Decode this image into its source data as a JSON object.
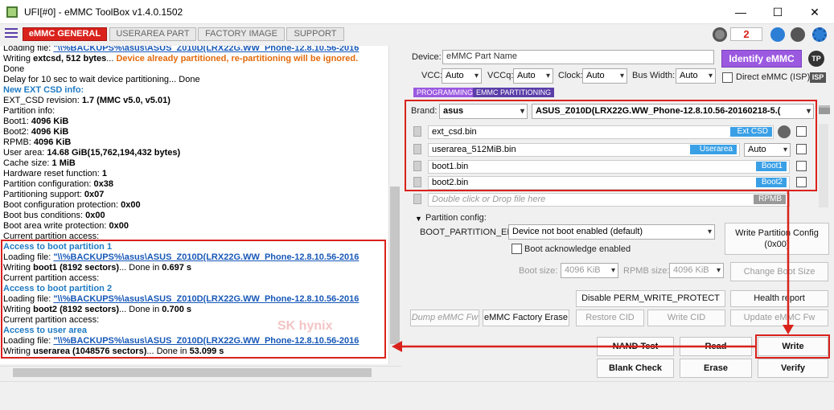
{
  "window": {
    "title": "UFI[#0] - eMMC ToolBox v1.4.0.1502",
    "min": "—",
    "max": "☐",
    "close": "✕"
  },
  "tabs": [
    "eMMC GENERAL",
    "USERAREA PART",
    "FACTORY IMAGE",
    "SUPPORT"
  ],
  "counter": "2",
  "log": [
    {
      "segs": [
        {
          "t": "Loading file:  "
        },
        {
          "t": "\"\\\\%BACKUPS%\\asus\\ASUS_Z010D(LRX22G.WW_Phone-12.8.10.56-2016",
          "c": "link"
        }
      ]
    },
    {
      "segs": [
        {
          "t": "Writing "
        },
        {
          "t": "extcsd, 512 bytes",
          "c": "b"
        },
        {
          "t": "... "
        },
        {
          "t": "Device already partitioned, re-partitioning will be ignored.",
          "c": "orange"
        }
      ]
    },
    {
      "segs": [
        {
          "t": "Done"
        }
      ]
    },
    {
      "segs": [
        {
          "t": "Delay for 10 sec to wait device partitioning... Done"
        }
      ]
    },
    {
      "segs": [
        {
          "t": "New EXT CSD info:",
          "c": "blue"
        }
      ]
    },
    {
      "segs": [
        {
          "t": "EXT_CSD revision: "
        },
        {
          "t": "1.7 (MMC v5.0, v5.01)",
          "c": "b"
        }
      ]
    },
    {
      "segs": [
        {
          "t": "Partition info:"
        }
      ]
    },
    {
      "segs": [
        {
          "t": " Boot1: "
        },
        {
          "t": "4096 KiB",
          "c": "b"
        }
      ]
    },
    {
      "segs": [
        {
          "t": " Boot2: "
        },
        {
          "t": "4096 KiB",
          "c": "b"
        }
      ]
    },
    {
      "segs": [
        {
          "t": " RPMB: "
        },
        {
          "t": "4096 KiB",
          "c": "b"
        }
      ]
    },
    {
      "segs": [
        {
          "t": " User area: "
        },
        {
          "t": "14.68 GiB(15,762,194,432 bytes)",
          "c": "b"
        }
      ]
    },
    {
      "segs": [
        {
          "t": "Cache size: "
        },
        {
          "t": "1 MiB",
          "c": "b"
        }
      ]
    },
    {
      "segs": [
        {
          "t": "Hardware reset function: "
        },
        {
          "t": "1",
          "c": "b"
        }
      ]
    },
    {
      "segs": [
        {
          "t": "Partition configuration: "
        },
        {
          "t": "0x38",
          "c": "b"
        }
      ]
    },
    {
      "segs": [
        {
          "t": "Partitioning support: "
        },
        {
          "t": "0x07",
          "c": "b"
        }
      ]
    },
    {
      "segs": [
        {
          "t": "Boot configuration protection: "
        },
        {
          "t": "0x00",
          "c": "b"
        }
      ]
    },
    {
      "segs": [
        {
          "t": "Boot bus conditions: "
        },
        {
          "t": "0x00",
          "c": "b"
        }
      ]
    },
    {
      "segs": [
        {
          "t": "Boot area write protection: "
        },
        {
          "t": "0x00",
          "c": "b"
        }
      ]
    },
    {
      "segs": [
        {
          "t": "Current partition access:"
        }
      ]
    },
    {
      "segs": [
        {
          "t": " Access to boot partition 1",
          "c": "blue"
        }
      ]
    },
    {
      "segs": [
        {
          "t": "Loading file: "
        },
        {
          "t": "\"\\\\%BACKUPS%\\asus\\ASUS_Z010D(LRX22G.WW_Phone-12.8.10.56-2016",
          "c": "link"
        }
      ]
    },
    {
      "segs": [
        {
          "t": "Writing "
        },
        {
          "t": "boot1 (8192 sectors)",
          "c": "b"
        },
        {
          "t": "... Done in "
        },
        {
          "t": "0.697 s",
          "c": "b"
        }
      ]
    },
    {
      "segs": [
        {
          "t": "Current partition access:"
        }
      ]
    },
    {
      "segs": [
        {
          "t": " Access to boot partition 2",
          "c": "blue"
        }
      ]
    },
    {
      "segs": [
        {
          "t": "Loading file: "
        },
        {
          "t": "\"\\\\%BACKUPS%\\asus\\ASUS_Z010D(LRX22G.WW_Phone-12.8.10.56-2016",
          "c": "link"
        }
      ]
    },
    {
      "segs": [
        {
          "t": "Writing "
        },
        {
          "t": "boot2 (8192 sectors)",
          "c": "b"
        },
        {
          "t": "... Done in "
        },
        {
          "t": "0.700 s",
          "c": "b"
        }
      ]
    },
    {
      "segs": [
        {
          "t": "Current partition access:"
        }
      ]
    },
    {
      "segs": [
        {
          "t": " Access to user area",
          "c": "blue"
        }
      ]
    },
    {
      "segs": [
        {
          "t": "Loading file: "
        },
        {
          "t": "\"\\\\%BACKUPS%\\asus\\ASUS_Z010D(LRX22G.WW_Phone-12.8.10.56-2016",
          "c": "link"
        }
      ]
    },
    {
      "segs": [
        {
          "t": "Writing "
        },
        {
          "t": "userarea (1048576 sectors)",
          "c": "b"
        },
        {
          "t": "... Done in "
        },
        {
          "t": "53.099 s",
          "c": "b"
        }
      ]
    }
  ],
  "watermark": "SK hynix",
  "device": {
    "label": "Device:",
    "placeholder": "eMMC Part Name",
    "identify": "Identify eMMC",
    "tp": "TP"
  },
  "power": {
    "vcc_label": "VCC:",
    "vcc": "Auto",
    "vccq_label": "VCCq:",
    "vccq": "Auto",
    "clock_label": "Clock:",
    "clock": "Auto",
    "bus_label": "Bus Width:",
    "bus": "Auto",
    "direct": "Direct eMMC (ISP)",
    "isp": "ISP"
  },
  "subtabs": [
    "PROGRAMMING",
    "EMMC PARTITIONING"
  ],
  "brand": {
    "label": "Brand:",
    "value": "asus",
    "firmware": "ASUS_Z010D(LRX22G.WW_Phone-12.8.10.56-20160218-5.("
  },
  "files": [
    {
      "name": "ext_csd.bin",
      "badge": "Ext CSD",
      "extra": ""
    },
    {
      "name": "userarea_512MiB.bin",
      "badge": "Userarea",
      "extra": "Auto"
    },
    {
      "name": "boot1.bin",
      "badge": "Boot1",
      "extra": ""
    },
    {
      "name": "boot2.bin",
      "badge": "Boot2",
      "extra": ""
    },
    {
      "name": "Double click or Drop file here",
      "badge": "RPMB",
      "extra": ""
    }
  ],
  "partcfg": {
    "title": "Partition config:",
    "boot_label": "BOOT_PARTITION_EN",
    "boot_value": "Device not boot enabled (default)",
    "write_btn": "Write Partition Config (0x00)",
    "ack": "Boot acknowledge enabled",
    "bootsize_label": "Boot size:",
    "bootsize": "4096 KiB",
    "rpmbsize_label": "RPMB size:",
    "rpmbsize": "4096 KiB",
    "change_btn": "Change Boot Size"
  },
  "buttons": {
    "disable_perm": "Disable PERM_WRITE_PROTECT",
    "health": "Health report",
    "dump": "Dump eMMC Fw",
    "factory_erase": "eMMC Factory Erase",
    "restore_cid": "Restore CID",
    "write_cid": "Write CID",
    "update_fw": "Update eMMC Fw",
    "nand_test": "NAND Test",
    "read": "Read",
    "write": "Write",
    "blank_check": "Blank Check",
    "erase": "Erase",
    "verify": "Verify"
  },
  "colors": {
    "accent": "#d9221c",
    "purple": "#9b59e0",
    "badge_blue": "#3aa0e6",
    "badge_gray": "#9a9a9a"
  }
}
